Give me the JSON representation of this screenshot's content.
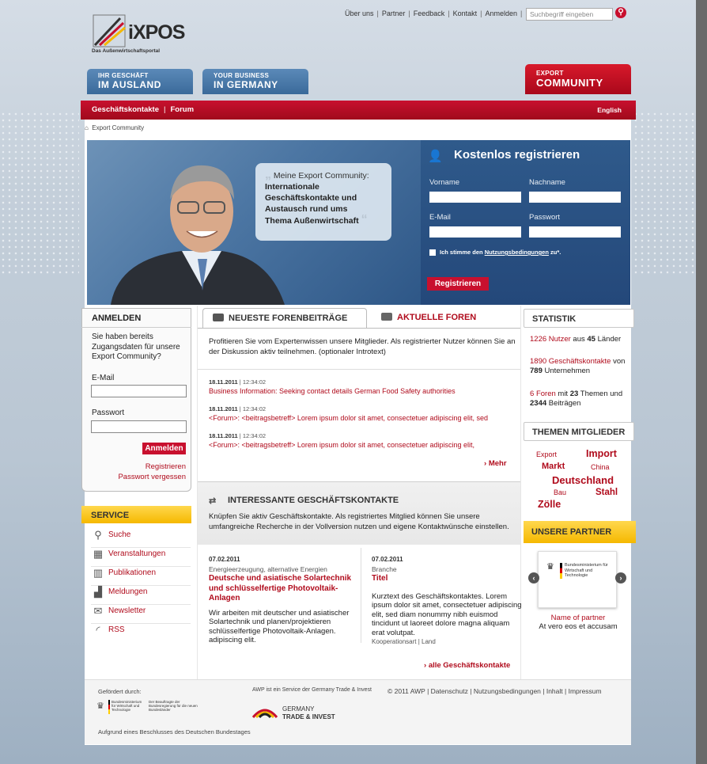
{
  "header": {
    "top_links": [
      "Über uns",
      "Partner",
      "Feedback",
      "Kontakt",
      "Anmelden"
    ],
    "search_placeholder": "Suchbegriff eingeben",
    "logo_title": "iXPOS",
    "logo_subtitle": "Das Außenwirtschaftsportal"
  },
  "tabs": [
    {
      "line1": "IHR GESCHÄFT",
      "line2": "IM AUSLAND"
    },
    {
      "line1": "YOUR BUSINESS",
      "line2": "IN GERMANY"
    },
    {
      "line1": "EXPORT",
      "line2": "COMMUNITY"
    }
  ],
  "nav": {
    "items": [
      "Geschäftskontakte",
      "Forum"
    ],
    "language": "English"
  },
  "breadcrumb": "Export Community",
  "hero": {
    "quote_intro": "Meine Export Community:",
    "quote_lines": [
      "Internationale",
      "Geschäftskontakte und",
      "Austausch rund ums",
      "Thema Außenwirtschaft"
    ]
  },
  "register": {
    "title": "Kostenlos registrieren",
    "firstname": "Vorname",
    "lastname": "Nachname",
    "email": "E-Mail",
    "password": "Passwort",
    "terms_pre": "Ich stimme den ",
    "terms_link": "Nutzungsbedingungen",
    "terms_post": " zu*.",
    "button": "Registrieren"
  },
  "login": {
    "title": "ANMELDEN",
    "intro": "Sie haben bereits Zugangsdaten für unsere Export Community?",
    "email": "E-Mail",
    "password": "Passwort",
    "button": "Anmelden",
    "register_link": "Registrieren",
    "forgot_link": "Passwort vergessen"
  },
  "service": {
    "title": "SERVICE",
    "items": [
      {
        "label": "Suche",
        "icon": "search-icon"
      },
      {
        "label": "Veranstaltungen",
        "icon": "calendar-icon"
      },
      {
        "label": "Publikationen",
        "icon": "books-icon"
      },
      {
        "label": "Meldungen",
        "icon": "chart-icon"
      },
      {
        "label": "Newsletter",
        "icon": "mail-icon"
      },
      {
        "label": "RSS",
        "icon": "rss-icon"
      }
    ]
  },
  "forum": {
    "tab_latest": "NEUESTE FORENBEITRÄGE",
    "tab_current": "AKTUELLE FOREN",
    "intro": "Profitieren Sie vom Expertenwissen unsere Mitglieder. Als registrierter Nutzer können Sie an der Diskussion aktiv teilnehmen. (optionaler Introtext)",
    "posts": [
      {
        "date": "18.11.2011",
        "time": "12:34:02",
        "title": "Business Information: Seeking contact details German Food Safety authorities"
      },
      {
        "date": "18.11.2011",
        "time": "12:34:02",
        "title": "<Forum>: <beitragsbetreff> Lorem ipsum dolor sit amet, consectetuer adipiscing elit, sed"
      },
      {
        "date": "18.11.2011",
        "time": "12:34:02",
        "title": "<Forum>: <beitragsbetreff> Lorem ipsum dolor sit amet, consectetuer adipiscing elit,"
      }
    ],
    "more": "Mehr"
  },
  "contacts": {
    "title": "INTERESSANTE GESCHÄFTSKONTAKTE",
    "intro": "Knüpfen Sie aktiv Geschäftskontakte. Als registriertes Mitglied können Sie unsere umfangreiche Recherche in der Vollversion nutzen und eigene Kontaktwünsche einstellen.",
    "cards": [
      {
        "date": "07.02.2011",
        "category": "Energieerzeugung, alternative Energien",
        "title": "Deutsche und asiatische Solartechnik und schlüsselfertige Photovoltaik-Anlagen",
        "body": "Wir arbeiten mit deutscher und asiatischer Solartechnik und planen/projektieren schlüsselfertige Photovoltaik-Anlagen. adipiscing elit.",
        "meta": ""
      },
      {
        "date": "07.02.2011",
        "category": "Branche",
        "title": "Titel",
        "body": "Kurztext des Geschäftskontaktes. Lorem ipsum dolor sit amet, consectetuer adipiscing elit, sed diam nonummy nibh euismod tincidunt ut laoreet dolore magna aliquam erat volutpat.",
        "meta": "Kooperationsart | Land"
      }
    ],
    "all_link": "alle Geschäftskontakte"
  },
  "stats": {
    "title": "STATISTIK",
    "users": "1226",
    "users_label": "Nutzer",
    "users_mid": " aus ",
    "countries": "45",
    "countries_label": " Länder",
    "contacts": "1890",
    "contacts_label": "Geschäftskontakte",
    "contacts_mid": " von ",
    "companies": "789",
    "companies_label": " Unternehmen",
    "forums": "6",
    "forums_label": "Foren",
    "forums_mid": " mit ",
    "topics": "23",
    "topics_label": " Themen und ",
    "posts": "2344",
    "posts_label": " Beiträgen"
  },
  "topics": {
    "title": "THEMEN MITGLIEDER",
    "tags": [
      "Export",
      "Import",
      "Markt",
      "China",
      "Deutschland",
      "Bau",
      "Stahl",
      "Zölle"
    ]
  },
  "partners": {
    "title": "UNSERE PARTNER",
    "ministry": "Bundesministerium für Wirtschaft und Technologie",
    "name": "Name of partner",
    "desc": "At vero eos et accusam"
  },
  "footer": {
    "funded_by": "Gefördert durch:",
    "ministry": "Bundesministerium für Wirtschaft und Technologie",
    "commissioner": "Der Beauftragte der Bundesregierung für die neuen Bundesländer",
    "resolution": "Aufgrund eines Beschlusses des Deutschen Bundestages",
    "service_note": "AWP ist ein Service der Germany Trade & Invest",
    "gtai_line1": "GERMANY",
    "gtai_line2": "TRADE & INVEST",
    "copyright": "© 2011 AWP",
    "links": [
      "Datenschutz",
      "Nutzungsbedingungen",
      "Inhalt",
      "Impressum"
    ]
  },
  "colors": {
    "brand_red": "#c8102e",
    "nav_blue": "#3a6a9a",
    "service_yellow": "#f5b800"
  }
}
